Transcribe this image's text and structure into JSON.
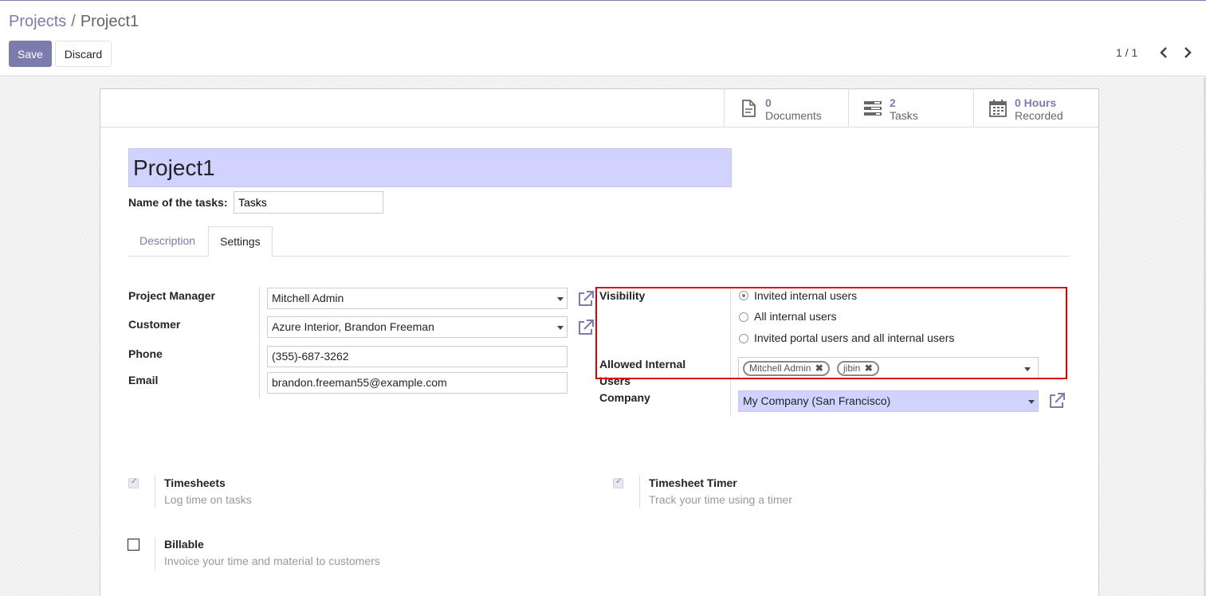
{
  "breadcrumb": {
    "parent": "Projects",
    "separator": "/",
    "current": "Project1"
  },
  "toolbar": {
    "save_label": "Save",
    "discard_label": "Discard"
  },
  "pager": {
    "value": "1 / 1",
    "prev_icon": "chevron-left-icon",
    "next_icon": "chevron-right-icon"
  },
  "stats": [
    {
      "value": "0",
      "label": "Documents",
      "icon": "document-icon"
    },
    {
      "value": "2",
      "label": "Tasks",
      "icon": "tasks-icon"
    },
    {
      "value": "0 Hours",
      "label": "Recorded",
      "icon": "calendar-icon"
    }
  ],
  "project": {
    "name": "Project1",
    "task_name_label": "Name of the tasks:",
    "task_name_value": "Tasks"
  },
  "tabs": [
    {
      "label": "Description",
      "active": false
    },
    {
      "label": "Settings",
      "active": true
    }
  ],
  "fields": {
    "project_manager": {
      "label": "Project Manager",
      "value": "Mitchell Admin"
    },
    "customer": {
      "label": "Customer",
      "value": "Azure Interior, Brandon Freeman"
    },
    "phone": {
      "label": "Phone",
      "value": "(355)-687-3262"
    },
    "email": {
      "label": "Email",
      "value": "brandon.freeman55@example.com"
    },
    "visibility": {
      "label": "Visibility",
      "options": [
        {
          "label": "Invited internal users",
          "selected": true
        },
        {
          "label": "All internal users",
          "selected": false
        },
        {
          "label": "Invited portal users and all internal users",
          "selected": false
        }
      ]
    },
    "allowed_users": {
      "label_line1": "Allowed Internal",
      "label_line2": "Users",
      "tags": [
        "Mitchell Admin",
        "jibin"
      ]
    },
    "company": {
      "label": "Company",
      "value": "My Company (San Francisco)"
    }
  },
  "options": [
    {
      "title": "Timesheets",
      "desc": "Log time on tasks",
      "checked": true
    },
    {
      "title": "Timesheet Timer",
      "desc": "Track your time using a timer",
      "checked": true
    },
    {
      "title": "Billable",
      "desc": "Invoice your time and material to customers",
      "checked": false
    }
  ],
  "colors": {
    "brand": "#7c7bad",
    "highlight": "#e00000",
    "required_bg": "#d2d2ff"
  }
}
